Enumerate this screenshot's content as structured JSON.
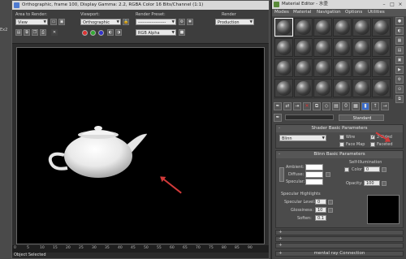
{
  "left_bg": {
    "label": "Ex2"
  },
  "render_window": {
    "title": "Orthographic, frame 100, Display Gamma: 2.2, RGBA Color 16 Bits/Channel (1:1)",
    "area_label": "Area to Render:",
    "area_value": "View",
    "viewport_label": "Viewport:",
    "viewport_value": "Orthographic",
    "preset_label": "Render Preset:",
    "preset_value": "-------------------",
    "render_label": "Render",
    "render_value": "Production",
    "channel_value": "RGB Alpha",
    "ruler_ticks": [
      "0",
      "5",
      "10",
      "15",
      "20",
      "25",
      "30",
      "35",
      "40",
      "45",
      "50",
      "55",
      "60",
      "65",
      "70",
      "75",
      "80",
      "85",
      "90"
    ],
    "status": "Object Selected"
  },
  "material_editor": {
    "title": "Material Editor - 水壶",
    "menu": [
      "Modes",
      "Material",
      "Navigation",
      "Options",
      "Utilities"
    ],
    "material_type": "Standard",
    "shader_rollout": {
      "title": "Shader Basic Parameters",
      "shader": "Blinn",
      "wire": "Wire",
      "two_sided": "2-Sided",
      "face_map": "Face Map",
      "faceted": "Faceted",
      "two_sided_checked": true
    },
    "blinn_rollout": {
      "title": "Blinn Basic Parameters",
      "self_illum_label": "Self-Illumination",
      "color_label": "Color",
      "color_value": "0",
      "ambient": "Ambient:",
      "diffuse": "Diffuse:",
      "specular": "Specular:",
      "opacity_label": "Opacity:",
      "opacity_value": "100",
      "spec_highlights": "Specular Highlights",
      "spec_level_label": "Specular Level:",
      "spec_level_value": "0",
      "glossiness_label": "Glossiness:",
      "glossiness_value": "10",
      "soften_label": "Soften:",
      "soften_value": "0.1"
    },
    "closed_rollouts": [
      "mental ray Connection"
    ]
  },
  "colors": {
    "accent_arrow": "#d23a3a",
    "titlebar": "#d8d8d8",
    "viewport_bg": "#000000"
  }
}
